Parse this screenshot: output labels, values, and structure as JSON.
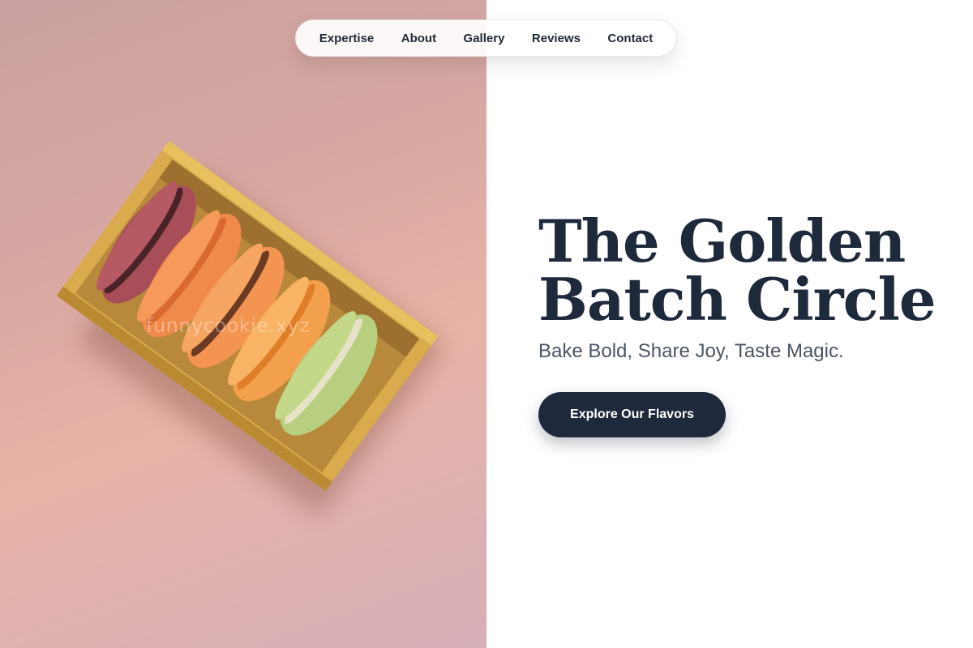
{
  "nav": {
    "items": [
      {
        "label": "Expertise"
      },
      {
        "label": "About"
      },
      {
        "label": "Gallery"
      },
      {
        "label": "Reviews"
      },
      {
        "label": "Contact"
      }
    ]
  },
  "hero": {
    "title_line1": "The Golden",
    "title_line2": "Batch Circle",
    "subtitle": "Bake Bold, Share Joy, Taste Magic.",
    "cta_label": "Explore Our Flavors",
    "image": {
      "subject": "macarons-in-yellow-box",
      "watermark": "funnycookie.xyz"
    }
  },
  "colors": {
    "dark": "#1e293b",
    "subtitle": "#4b5563",
    "box": "#d7a94a",
    "background_pink": "#e2b0a8"
  }
}
